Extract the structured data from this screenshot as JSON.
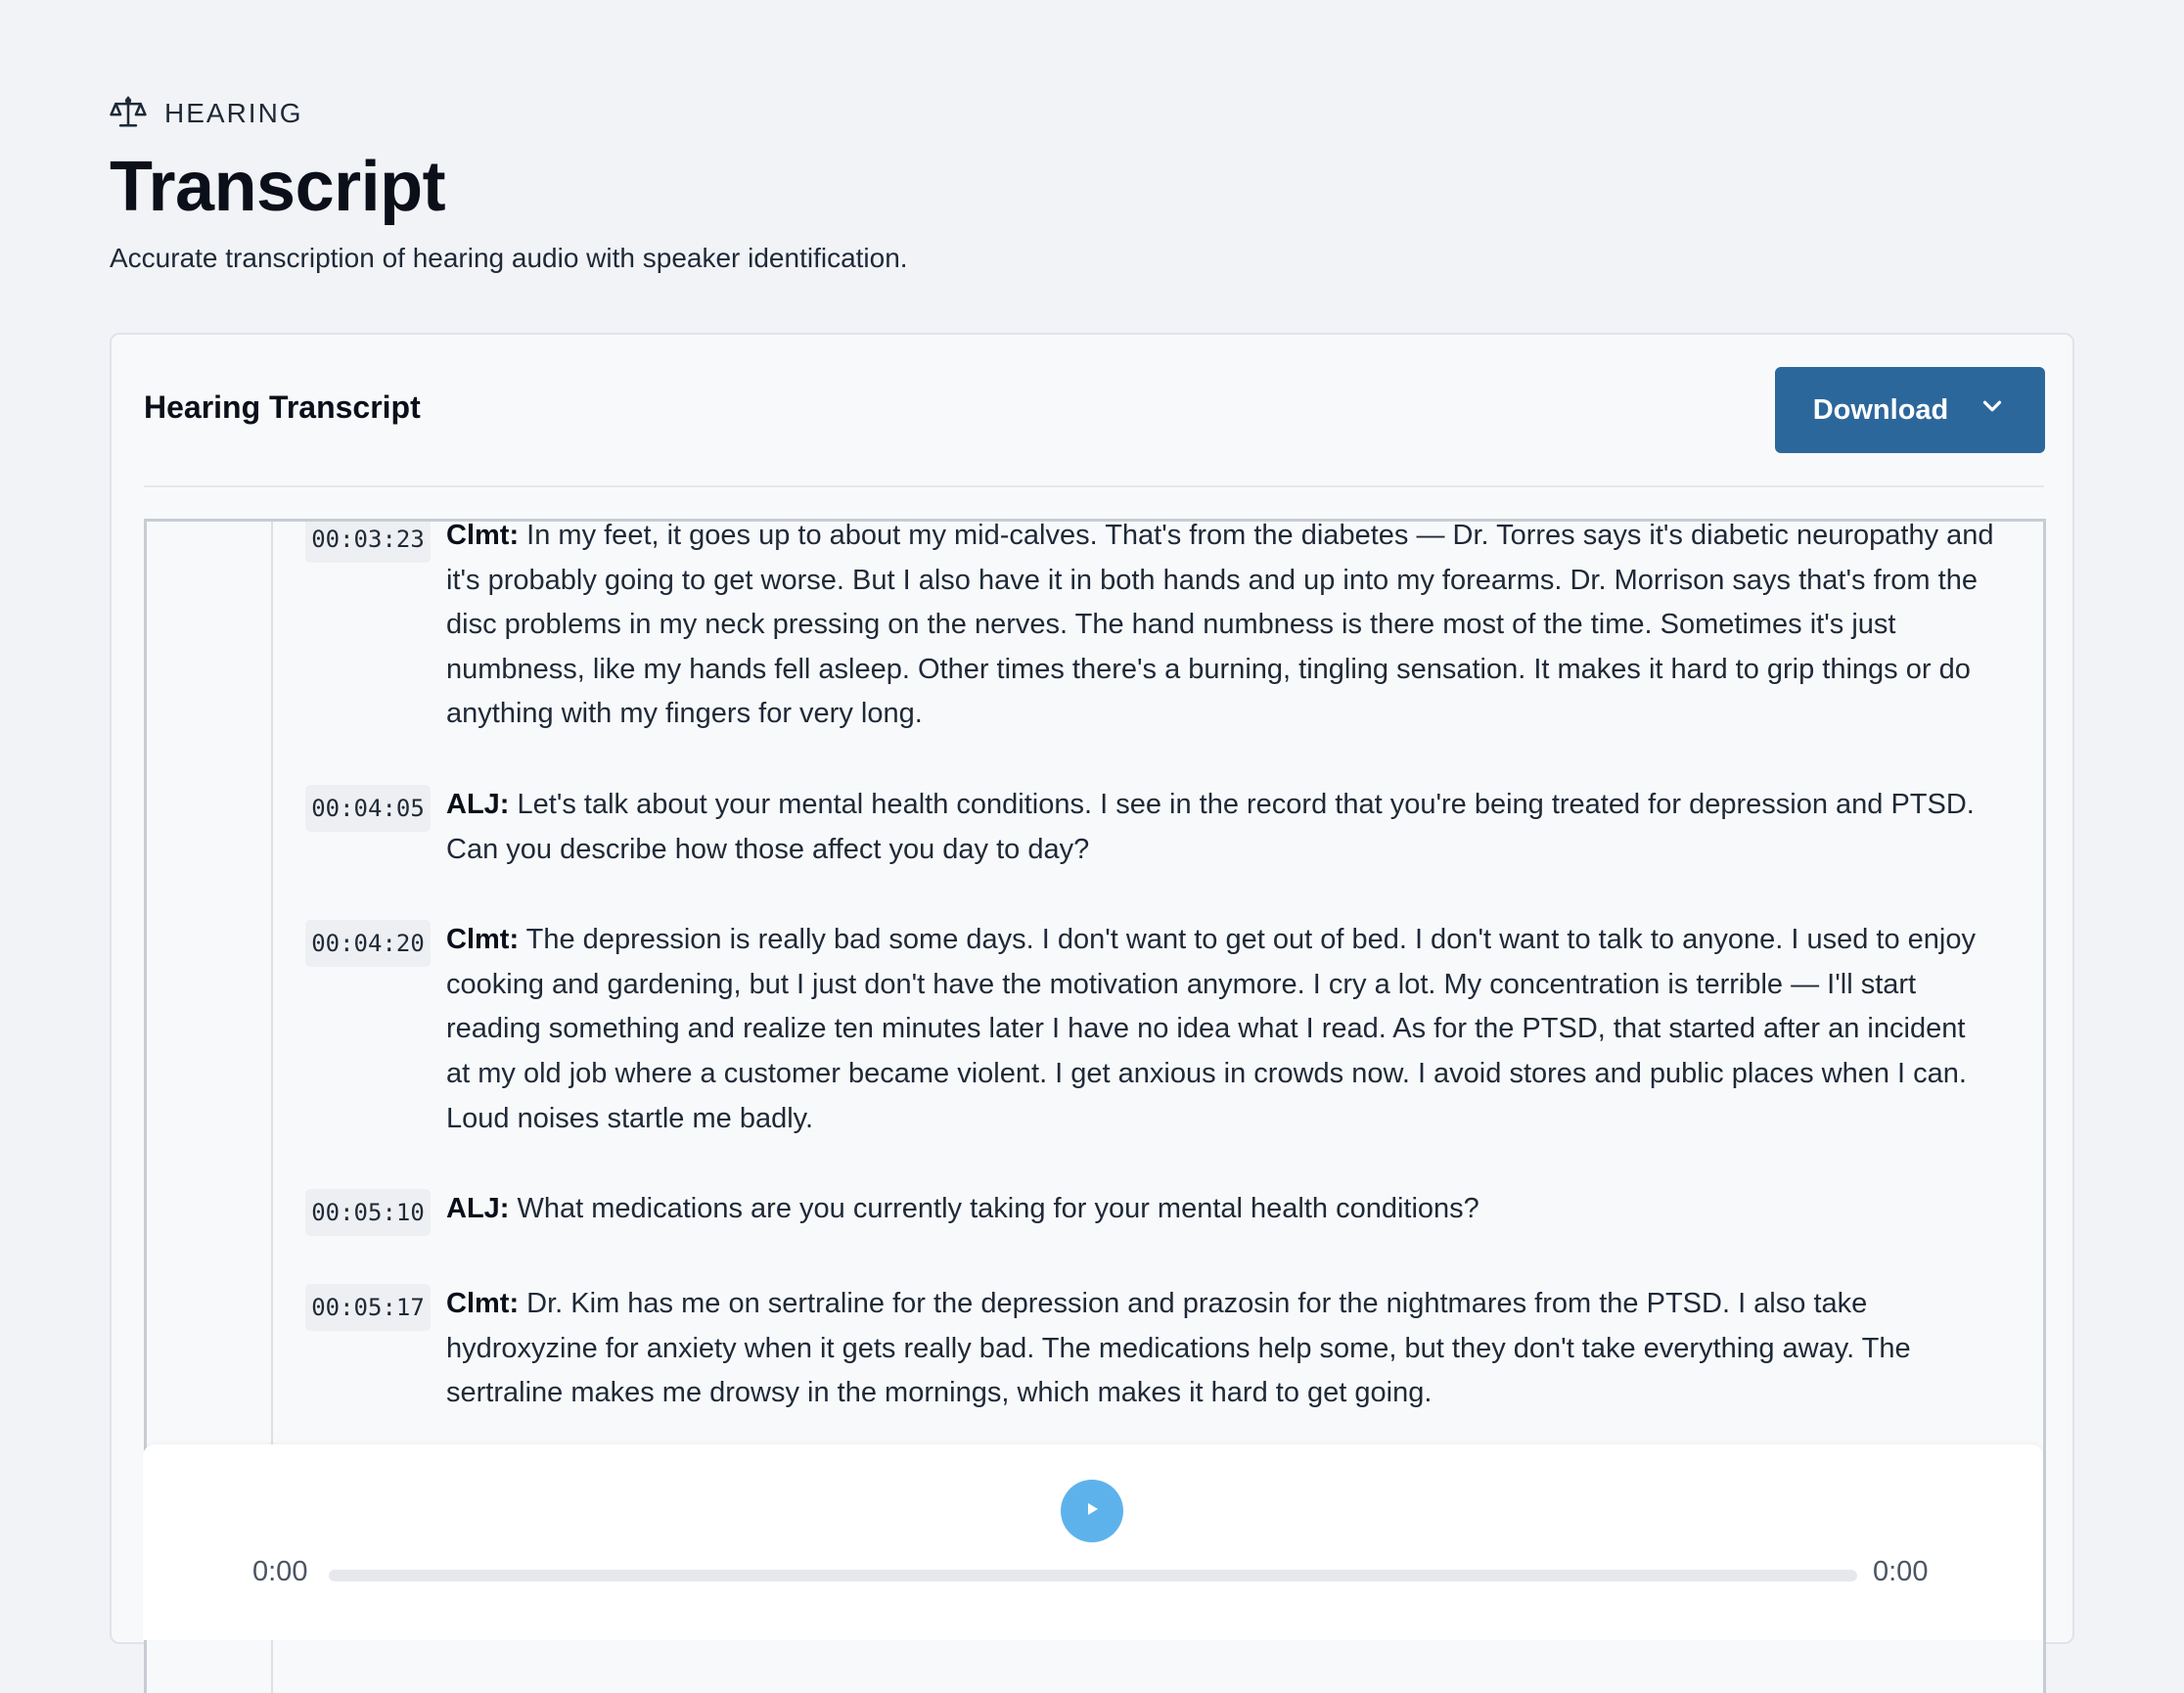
{
  "header": {
    "eyebrow": "HEARING",
    "eyebrow_icon": "scale-icon",
    "title": "Transcript",
    "subtitle": "Accurate transcription of hearing audio with speaker identification."
  },
  "card": {
    "title": "Hearing Transcript",
    "download_label": "Download",
    "download_icon": "chevron-down-icon"
  },
  "transcript": {
    "entries": [
      {
        "time": "00:03:23",
        "speaker": "Clmt:",
        "text": "In my feet, it goes up to about my mid-calves. That's from the diabetes — Dr. Torres says it's diabetic neuropathy and it's probably going to get worse. But I also have it in both hands and up into my forearms. Dr. Morrison says that's from the disc problems in my neck pressing on the nerves. The hand numbness is there most of the time. Sometimes it's just numbness, like my hands fell asleep. Other times there's a burning, tingling sensation. It makes it hard to grip things or do anything with my fingers for very long."
      },
      {
        "time": "00:04:05",
        "speaker": "ALJ:",
        "text": "Let's talk about your mental health conditions. I see in the record that you're being treated for depression and PTSD. Can you describe how those affect you day to day?"
      },
      {
        "time": "00:04:20",
        "speaker": "Clmt:",
        "text": "The depression is really bad some days. I don't want to get out of bed. I don't want to talk to anyone. I used to enjoy cooking and gardening, but I just don't have the motivation anymore. I cry a lot. My concentration is terrible — I'll start reading something and realize ten minutes later I have no idea what I read. As for the PTSD, that started after an incident at my old job where a customer became violent. I get anxious in crowds now. I avoid stores and public places when I can. Loud noises startle me badly."
      },
      {
        "time": "00:05:10",
        "speaker": "ALJ:",
        "text": "What medications are you currently taking for your mental health conditions?"
      },
      {
        "time": "00:05:17",
        "speaker": "Clmt:",
        "text": "Dr. Kim has me on sertraline for the depression and prazosin for the nightmares from the PTSD. I also take hydroxyzine for anxiety when it gets really bad. The medications help some, but they don't take everything away. The sertraline makes me drowsy in the mornings, which makes it hard to get going."
      }
    ]
  },
  "player": {
    "current_time": "0:00",
    "total_time": "0:00",
    "progress": 0,
    "play_icon": "play-icon"
  },
  "colors": {
    "background": "#f1f3f7",
    "accent": "#2c679c",
    "play": "#5eb2ec"
  }
}
